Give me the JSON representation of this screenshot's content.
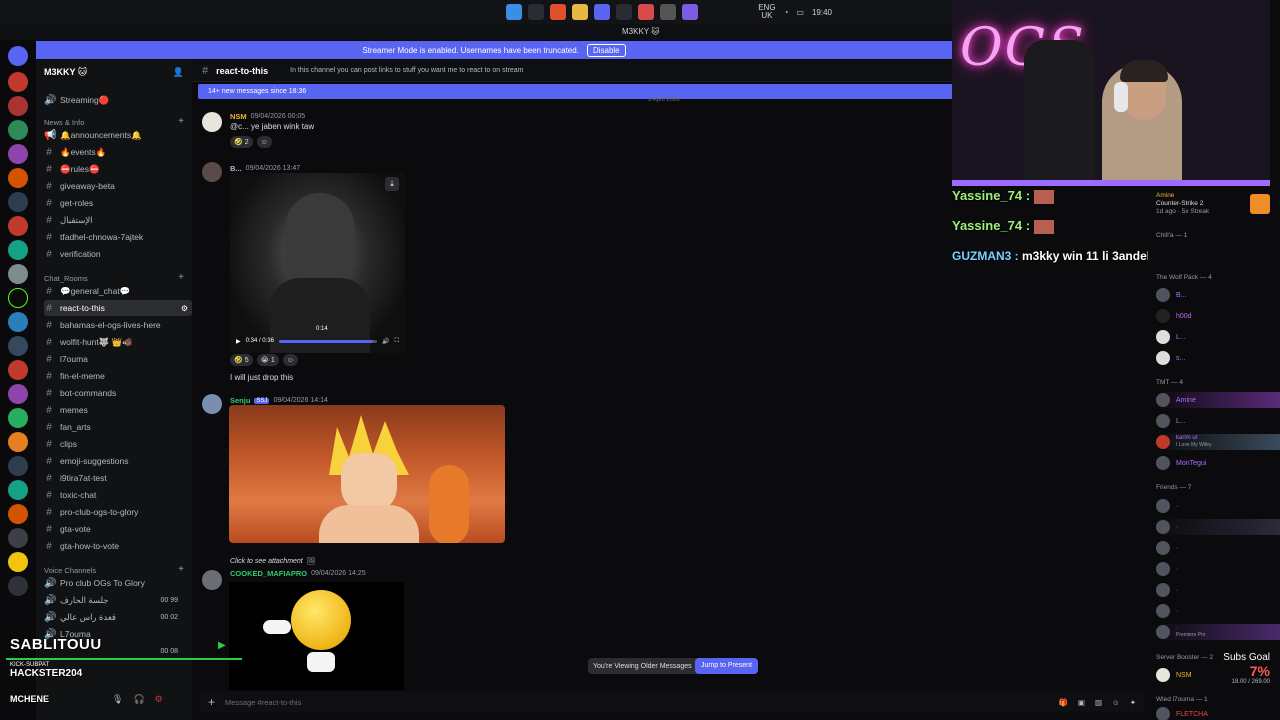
{
  "taskbar": {
    "lang": "ENG",
    "region": "UK",
    "time": "19:40"
  },
  "window": {
    "title": "M3KKY 🐱"
  },
  "streamer_banner": {
    "text": "Streamer Mode is enabled. Usernames have been truncated.",
    "button": "Disable"
  },
  "server": {
    "name": "M3KKY 🐱"
  },
  "sidebar": {
    "streaming": "Streaming🔴",
    "category_news": "News & Info",
    "category_chat": "Chat_Rooms",
    "category_voice": "Voice Channels",
    "channels_top": [
      {
        "label": "🔔announcements🔔"
      },
      {
        "label": "🔥events🔥"
      },
      {
        "label": "⛔rules⛔"
      },
      {
        "label": "giveaway-beta"
      },
      {
        "label": "get-roles"
      },
      {
        "label": "الإستقبال"
      },
      {
        "label": "tfadhel-chnowa-7ajtek"
      },
      {
        "label": "verification"
      }
    ],
    "channels_chat": [
      {
        "label": "💬general_chat💬"
      },
      {
        "label": "react-to-this"
      },
      {
        "label": "bahamas-el-ogs-lives-here"
      },
      {
        "label": "wolfit-hunt🐺 👑🐗"
      },
      {
        "label": "l7ouma"
      },
      {
        "label": "fin-el-meme"
      },
      {
        "label": "bot-commands"
      },
      {
        "label": "memes"
      },
      {
        "label": "fan_arts"
      },
      {
        "label": "clips"
      },
      {
        "label": "emoji-suggestions"
      },
      {
        "label": "i9tira7at-test"
      },
      {
        "label": "toxic-chat"
      },
      {
        "label": "pro-club-ogs-to-glory"
      },
      {
        "label": "gta-vote"
      },
      {
        "label": "gta-how-to-vote"
      }
    ],
    "voice": [
      {
        "label": "Pro club OGs To Glory",
        "count": ""
      },
      {
        "label": "جلسة الحارف",
        "count": "00 99"
      },
      {
        "label": "قعدة راس عالي",
        "count": "00 02"
      },
      {
        "label": "L7ouma",
        "count": ""
      },
      {
        "label": "",
        "count": "00 08"
      }
    ]
  },
  "channel": {
    "name": "react-to-this",
    "topic": "In this channel you can post links to stuff you want me to react to on stream",
    "new_messages": "14+ new messages since 18:36",
    "date_divider": "9 April 2026"
  },
  "messages": [
    {
      "user": "NSM",
      "time": "09/04/2026 00:05",
      "text": "@c... ye jaben wink taw",
      "reaction": "2"
    },
    {
      "user": "B...",
      "time": "09/04/2026 13:47",
      "text": "I will just drop this",
      "video_time": "0:34 / 0:36",
      "hover_time": "0:14",
      "reactions": [
        "5",
        "1"
      ]
    },
    {
      "user": "Senju",
      "tag": "SSJ",
      "time": "09/04/2026 14:14"
    },
    {
      "user": "COOKED_MAFIAPRO",
      "time": "09/04/2026 14:25",
      "reply": "Click to see attachment"
    }
  ],
  "older": {
    "text": "You're Viewing Older Messages",
    "button": "Jump to Present"
  },
  "composer": {
    "placeholder": "Message #react-to-this"
  },
  "overlay_chat": [
    {
      "user": "Yassine_74 :",
      "text": ""
    },
    {
      "user": "Yassine_74 :",
      "text": ""
    },
    {
      "user": "GUZMAN3 :",
      "text": "m3kky win 11 li 3andek?"
    }
  ],
  "members": {
    "top_user": "Amine",
    "top_activity": "Counter-Strike 2",
    "top_sub": "1d ago · 5x Streak",
    "groups": [
      {
        "title": "Chill'a — 1"
      },
      {
        "title": "The Wolf Pack — 4"
      },
      {
        "title": "TMT — 4"
      },
      {
        "title": "Friends — 7"
      },
      {
        "title": "Server Booster — 2"
      },
      {
        "title": "Wled l7ouma — 1"
      }
    ],
    "wolf": [
      "B...",
      "h00d",
      "L...",
      "s..."
    ],
    "tmt": [
      "Amine",
      "L...",
      "karim ur",
      "MonTegui"
    ],
    "tmt_sub": "I Love My Wifey",
    "friends_status": "Premiere Pro",
    "booster": "NSM",
    "wled": "FLETCHA"
  },
  "subs_goal": {
    "label": "Subs Goal",
    "percent": "7%",
    "progress": "18.00 / 269.00"
  },
  "stream_overlay": {
    "name": "SABLITOUU",
    "sub": "HACKSTER204",
    "sub_label": "KICK-SUBPAT",
    "third": "MCHENE"
  },
  "colors": {
    "accent": "#5865f2",
    "neon": "#ff4bd8",
    "kick": "#53fc18"
  }
}
